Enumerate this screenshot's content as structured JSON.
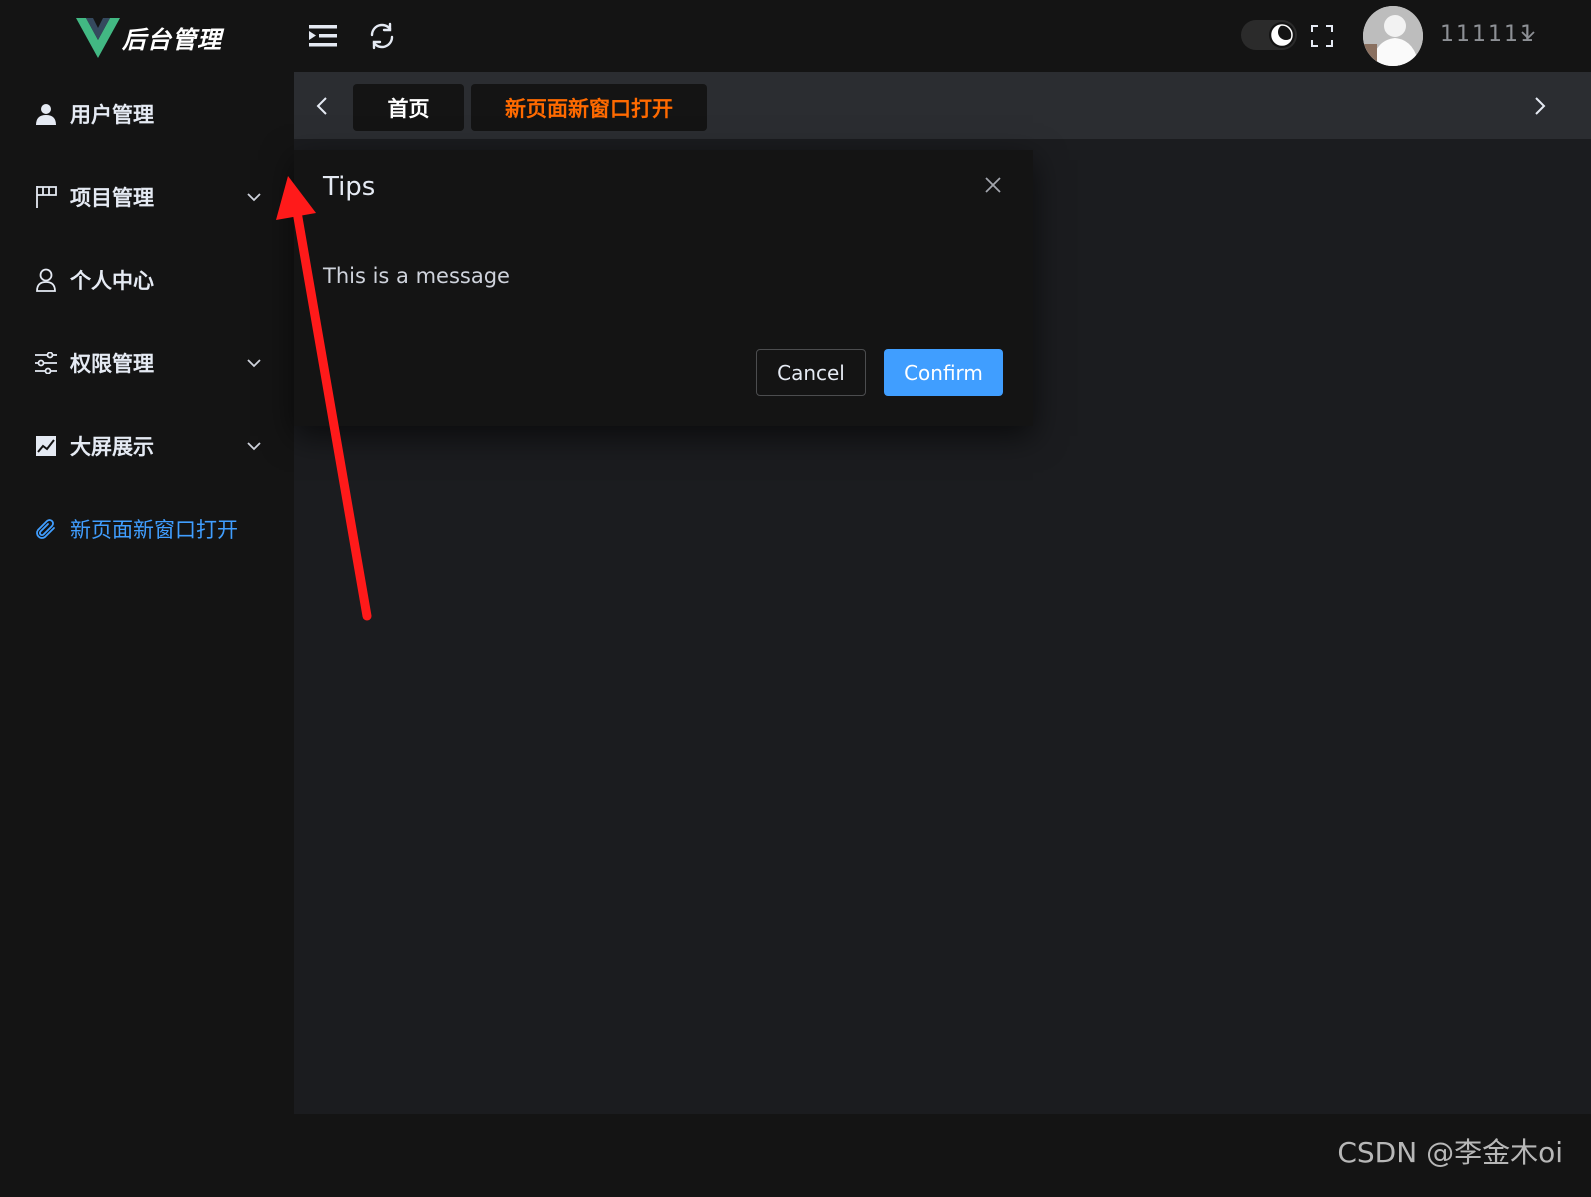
{
  "header": {
    "logo_text": "后台管理",
    "username": "111111",
    "colors": {
      "logo_green": "#42b883",
      "logo_dark": "#35495e"
    }
  },
  "sidebar": {
    "items": [
      {
        "label": "用户管理",
        "icon": "user-icon",
        "has_submenu": false
      },
      {
        "label": "项目管理",
        "icon": "flag-icon",
        "has_submenu": true
      },
      {
        "label": "个人中心",
        "icon": "user-outline-icon",
        "has_submenu": false
      },
      {
        "label": "权限管理",
        "icon": "sliders-icon",
        "has_submenu": true
      },
      {
        "label": "大屏展示",
        "icon": "chart-icon",
        "has_submenu": true
      },
      {
        "label": "新页面新窗口打开",
        "icon": "paperclip-icon",
        "has_submenu": false,
        "active": true
      }
    ]
  },
  "tags": [
    {
      "label": "首页",
      "active": false
    },
    {
      "label": "新页面新窗口打开",
      "active": true
    }
  ],
  "dialog": {
    "title": "Tips",
    "message": "This is a message",
    "cancel_label": "Cancel",
    "confirm_label": "Confirm"
  },
  "watermark": "CSDN @李金木oi",
  "colors": {
    "accent": "#409eff",
    "active_tag": "#ff6a00",
    "annotation_arrow": "#ff1a1a"
  }
}
